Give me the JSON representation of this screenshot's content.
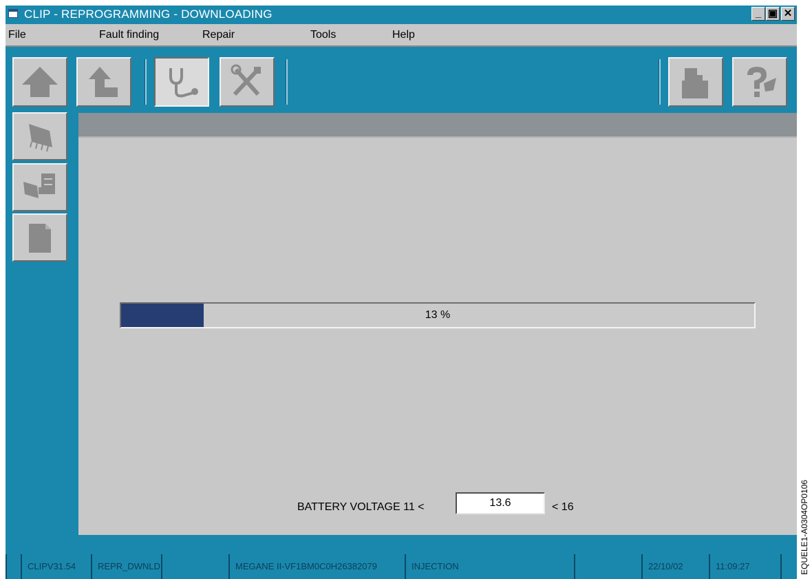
{
  "window": {
    "title": "CLIP - REPROGRAMMING - DOWNLOADING",
    "controls": {
      "minimize": "_",
      "maximize": "▣",
      "close": "✕"
    }
  },
  "menu": {
    "items": [
      "File",
      "Fault finding",
      "Repair",
      "Tools",
      "Help"
    ]
  },
  "toolbar": {
    "icons": [
      "home-arrow-icon",
      "back-arrow-icon",
      "stethoscope-icon",
      "tools-icon",
      "print-icon",
      "help-icon"
    ]
  },
  "sidebar": {
    "icons": [
      "ecu-chip-icon",
      "ecu-download-icon",
      "document-icon"
    ]
  },
  "progress": {
    "percent": 13,
    "label": "13 %"
  },
  "battery": {
    "label": "BATTERY VOLTAGE 11 <",
    "value": "13.6",
    "max_label": "< 16"
  },
  "status": {
    "version": "CLIPV31.54",
    "mode": "REPR_DWNLD",
    "blank1": "",
    "vehicle": "MEGANE II-VF1BM0C0H26382079",
    "system": "INJECTION",
    "blank2": "",
    "date": "22/10/02",
    "time": "11:09:27"
  },
  "watermark": "EQUELE1-A0304OP0106",
  "colors": {
    "desktop": "#1a88ad",
    "panel": "#c8c8c8",
    "progress_fill": "#263d73"
  }
}
